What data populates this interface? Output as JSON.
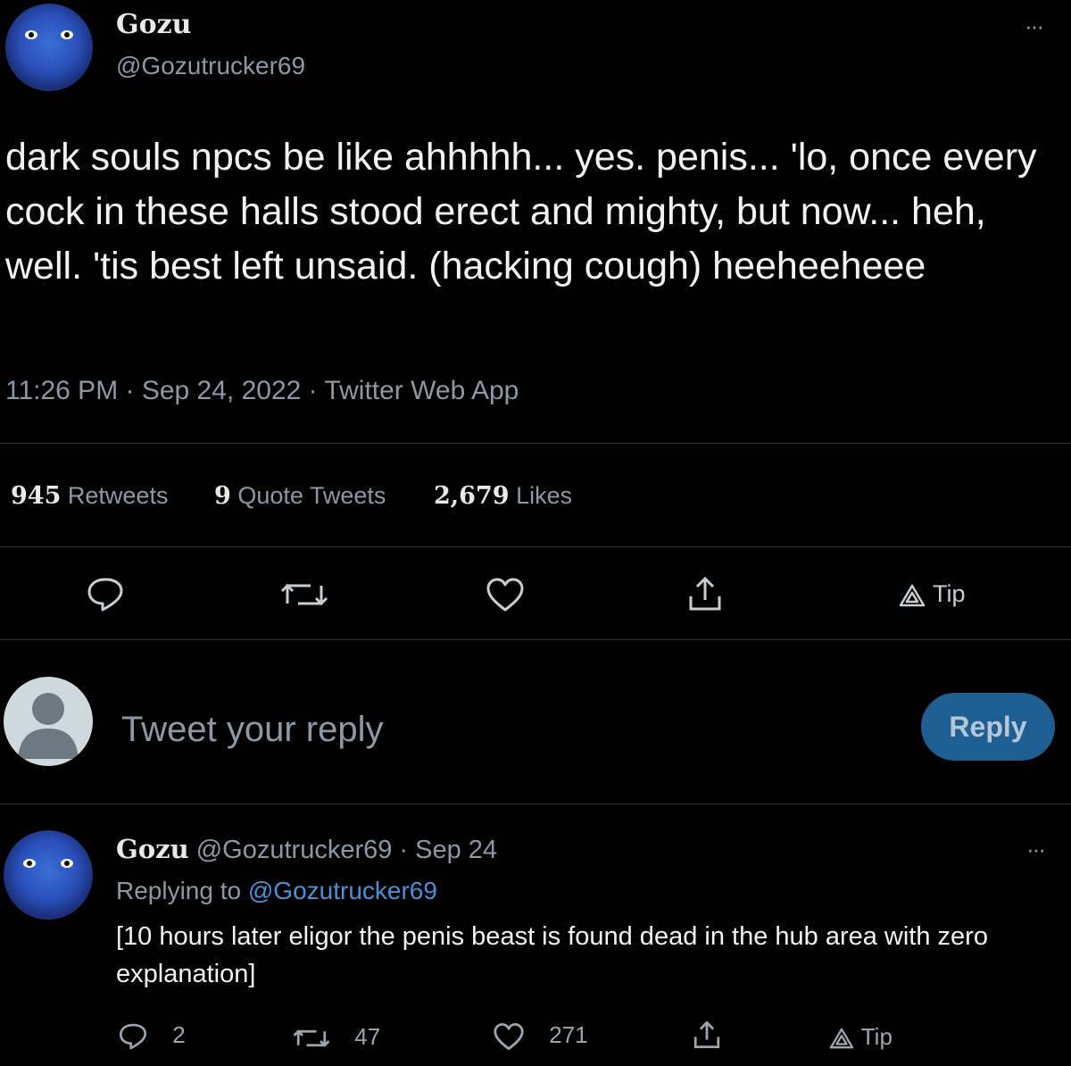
{
  "tweet": {
    "display_name": "Gozu",
    "handle": "@Gozutrucker69",
    "body": "dark souls npcs be like ahhhhh... yes. penis... 'lo, once every cock in these halls stood erect and mighty, but now... heh, well. 'tis best left unsaid. (hacking cough) heeheeheee",
    "timestamp": "11:26 PM · Sep 24, 2022 · Twitter Web App",
    "more": "···"
  },
  "stats": {
    "retweets_count": "945",
    "retweets_label": "Retweets",
    "quotes_count": "9",
    "quotes_label": "Quote Tweets",
    "likes_count": "2,679",
    "likes_label": "Likes"
  },
  "actions": {
    "tip_label": "Tip"
  },
  "composer": {
    "placeholder": "Tweet your reply",
    "reply_button": "Reply"
  },
  "reply": {
    "display_name": "Gozu",
    "handle_date": "@Gozutrucker69 · Sep 24",
    "replying_prefix": "Replying to",
    "replying_handle": "@Gozutrucker69",
    "body": "[10 hours later eligor the penis beast is found dead in the hub area with zero explanation]",
    "more": "···",
    "reply_count": "2",
    "retweet_count": "47",
    "like_count": "271",
    "tip_label": "Tip"
  },
  "colors": {
    "background": "#000000",
    "text": "#e7e9ea",
    "muted": "#8b98a5",
    "divider": "#2f3336",
    "reply_button": "#1d5f93",
    "link": "#4a8fd9"
  },
  "icons": [
    "reply-icon",
    "retweet-icon",
    "like-icon",
    "share-icon",
    "tip-icon",
    "more-icon",
    "default-avatar-icon"
  ]
}
